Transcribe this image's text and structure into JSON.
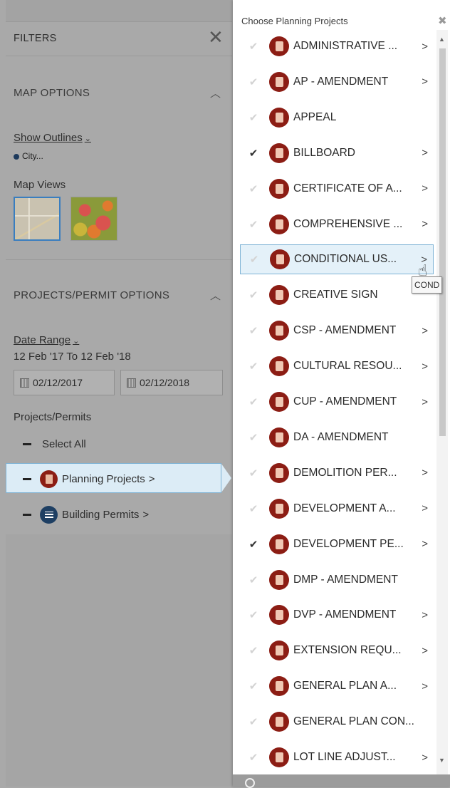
{
  "filters": {
    "title": "FILTERS",
    "close_icon": "close-icon",
    "map_options": {
      "title": "MAP OPTIONS",
      "show_outlines_label": "Show Outlines",
      "outline_value": "City...",
      "map_views_label": "Map Views",
      "views": [
        "street-map",
        "heat-map"
      ]
    },
    "projects_permit_options": {
      "title": "PROJECTS/PERMIT OPTIONS",
      "date_range_label": "Date Range",
      "date_range_text": "12 Feb '17 To 12 Feb '18",
      "start_date": "02/12/2017",
      "end_date": "02/12/2018",
      "projects_permits_label": "Projects/Permits",
      "select_all_label": "Select All",
      "categories": [
        {
          "label": "Planning Projects",
          "icon": "document-icon",
          "color": "#8c1d14",
          "selected": true
        },
        {
          "label": "Building Permits",
          "icon": "list-icon",
          "color": "#1e3f63",
          "selected": false
        }
      ]
    }
  },
  "chooser": {
    "title": "Choose Planning Projects",
    "tooltip": "COND",
    "items": [
      {
        "label": "ADMINISTRATIVE ...",
        "checked": false,
        "has_children": true
      },
      {
        "label": "AP - AMENDMENT",
        "checked": false,
        "has_children": true
      },
      {
        "label": "APPEAL",
        "checked": false,
        "has_children": false
      },
      {
        "label": "BILLBOARD",
        "checked": true,
        "has_children": true
      },
      {
        "label": "CERTIFICATE OF A...",
        "checked": false,
        "has_children": true
      },
      {
        "label": "COMPREHENSIVE ...",
        "checked": false,
        "has_children": true
      },
      {
        "label": "CONDITIONAL US...",
        "checked": false,
        "has_children": true,
        "hover": true
      },
      {
        "label": "CREATIVE SIGN",
        "checked": false,
        "has_children": false
      },
      {
        "label": "CSP - AMENDMENT",
        "checked": false,
        "has_children": true
      },
      {
        "label": "CULTURAL RESOU...",
        "checked": false,
        "has_children": true
      },
      {
        "label": "CUP - AMENDMENT",
        "checked": false,
        "has_children": true
      },
      {
        "label": "DA - AMENDMENT",
        "checked": false,
        "has_children": false
      },
      {
        "label": "DEMOLITION PER...",
        "checked": false,
        "has_children": true
      },
      {
        "label": "DEVELOPMENT A...",
        "checked": false,
        "has_children": true
      },
      {
        "label": "DEVELOPMENT PE...",
        "checked": true,
        "has_children": true
      },
      {
        "label": "DMP - AMENDMENT",
        "checked": false,
        "has_children": false
      },
      {
        "label": "DVP - AMENDMENT",
        "checked": false,
        "has_children": true
      },
      {
        "label": "EXTENSION REQU...",
        "checked": false,
        "has_children": true
      },
      {
        "label": "GENERAL PLAN A...",
        "checked": false,
        "has_children": true
      },
      {
        "label": "GENERAL PLAN CON...",
        "checked": false,
        "has_children": false
      },
      {
        "label": "LOT LINE ADJUST...",
        "checked": false,
        "has_children": true
      }
    ]
  }
}
